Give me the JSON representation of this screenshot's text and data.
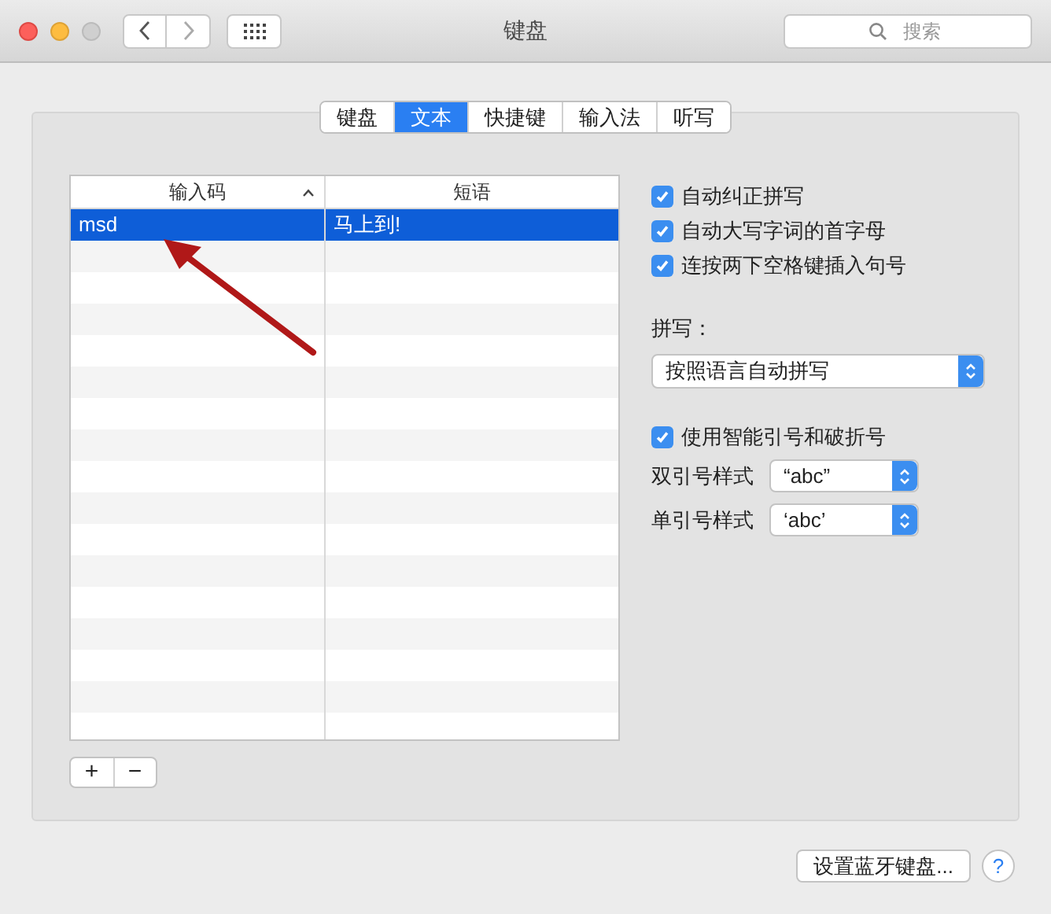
{
  "window": {
    "title": "键盘"
  },
  "search": {
    "placeholder": "搜索"
  },
  "tabs": [
    {
      "label": "键盘",
      "selected": false
    },
    {
      "label": "文本",
      "selected": true
    },
    {
      "label": "快捷键",
      "selected": false
    },
    {
      "label": "输入法",
      "selected": false
    },
    {
      "label": "听写",
      "selected": false
    }
  ],
  "table": {
    "columns": [
      {
        "label": "输入码",
        "sorted": true
      },
      {
        "label": "短语",
        "sorted": false
      }
    ],
    "rows": [
      {
        "cells": [
          "msd",
          "马上到!"
        ],
        "selected": true
      }
    ]
  },
  "list_buttons": [
    "+",
    "−"
  ],
  "options": [
    {
      "label": "自动纠正拼写",
      "checked": true
    },
    {
      "label": "自动大写字词的首字母",
      "checked": true
    },
    {
      "label": "连按两下空格键插入句号",
      "checked": true
    }
  ],
  "spelling": {
    "label": "拼写：",
    "value": "按照语言自动拼写"
  },
  "smart_quotes": {
    "label": "使用智能引号和破折号",
    "checked": true
  },
  "quote_styles": [
    {
      "label": "双引号样式",
      "value": "“abc”"
    },
    {
      "label": "单引号样式",
      "value": "‘abc’"
    }
  ],
  "footer": {
    "button": "设置蓝牙键盘...",
    "help": "?"
  }
}
